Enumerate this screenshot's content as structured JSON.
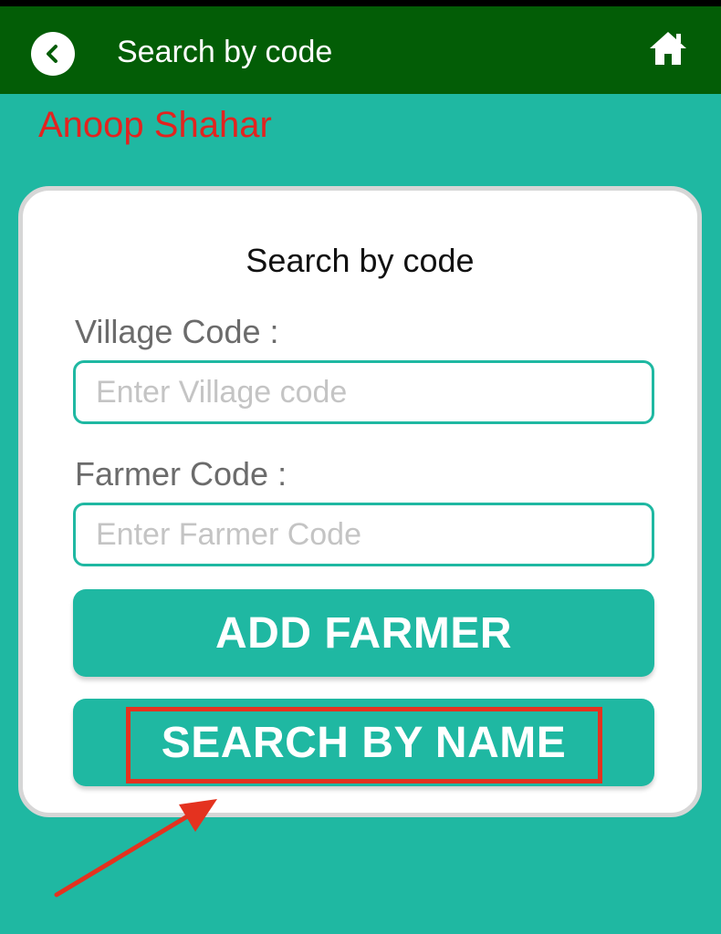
{
  "header": {
    "title": "Search by code",
    "back_icon": "chevron-left-icon",
    "home_icon": "home-icon",
    "background_color": "#035d06"
  },
  "location": {
    "name": "Anoop Shahar",
    "color": "#e3231f"
  },
  "card": {
    "title": "Search by code",
    "village": {
      "label": "Village Code :",
      "value": "",
      "placeholder": "Enter Village code"
    },
    "farmer": {
      "label": "Farmer Code :",
      "value": "",
      "placeholder": "Enter Farmer Code"
    },
    "add_farmer_label": "ADD FARMER",
    "search_by_name_label": "SEARCH BY NAME"
  },
  "annotation": {
    "highlight_color": "#e4321f",
    "arrow_icon": "arrow-icon"
  },
  "theme": {
    "accent": "#1fb8a2"
  }
}
